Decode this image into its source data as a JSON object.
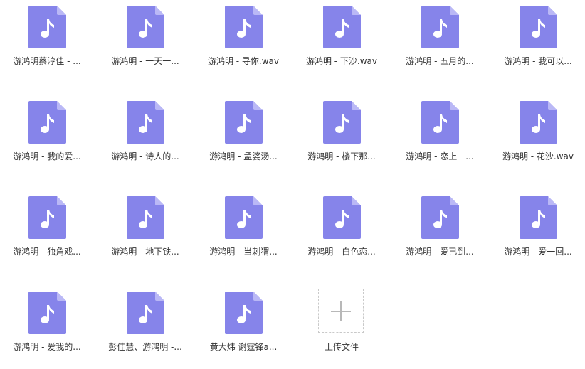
{
  "colors": {
    "file_icon_body": "#8684ea",
    "file_icon_fold": "#bab8f6",
    "note_glyph": "#ffffff"
  },
  "file_icon": "music-file-icon",
  "files": [
    {
      "name": "游鸿明蔡淳佳 - ..."
    },
    {
      "name": "游鸿明 - 一天一..."
    },
    {
      "name": "游鸿明 - 寻你.wav"
    },
    {
      "name": "游鸿明 - 下沙.wav"
    },
    {
      "name": "游鸿明 - 五月的..."
    },
    {
      "name": "游鸿明 - 我可以..."
    },
    {
      "name": "游鸿明 - 我的爱..."
    },
    {
      "name": "游鸿明 - 诗人的..."
    },
    {
      "name": "游鸿明 - 孟婆汤..."
    },
    {
      "name": "游鸿明 - 楼下那..."
    },
    {
      "name": "游鸿明 - 恋上一..."
    },
    {
      "name": "游鸿明 - 花沙.wav"
    },
    {
      "name": "游鸿明 - 独角戏..."
    },
    {
      "name": "游鸿明 - 地下铁..."
    },
    {
      "name": "游鸿明 - 当刺猬..."
    },
    {
      "name": "游鸿明 - 白色恋..."
    },
    {
      "name": "游鸿明 - 爱已到..."
    },
    {
      "name": "游鸿明 - 爱一回..."
    },
    {
      "name": "游鸿明 - 爱我的..."
    },
    {
      "name": "彭佳慧、游鸿明 -..."
    },
    {
      "name": "黄大炜 谢霆锋a..."
    }
  ],
  "upload": {
    "label": "上传文件",
    "icon": "plus-icon"
  }
}
